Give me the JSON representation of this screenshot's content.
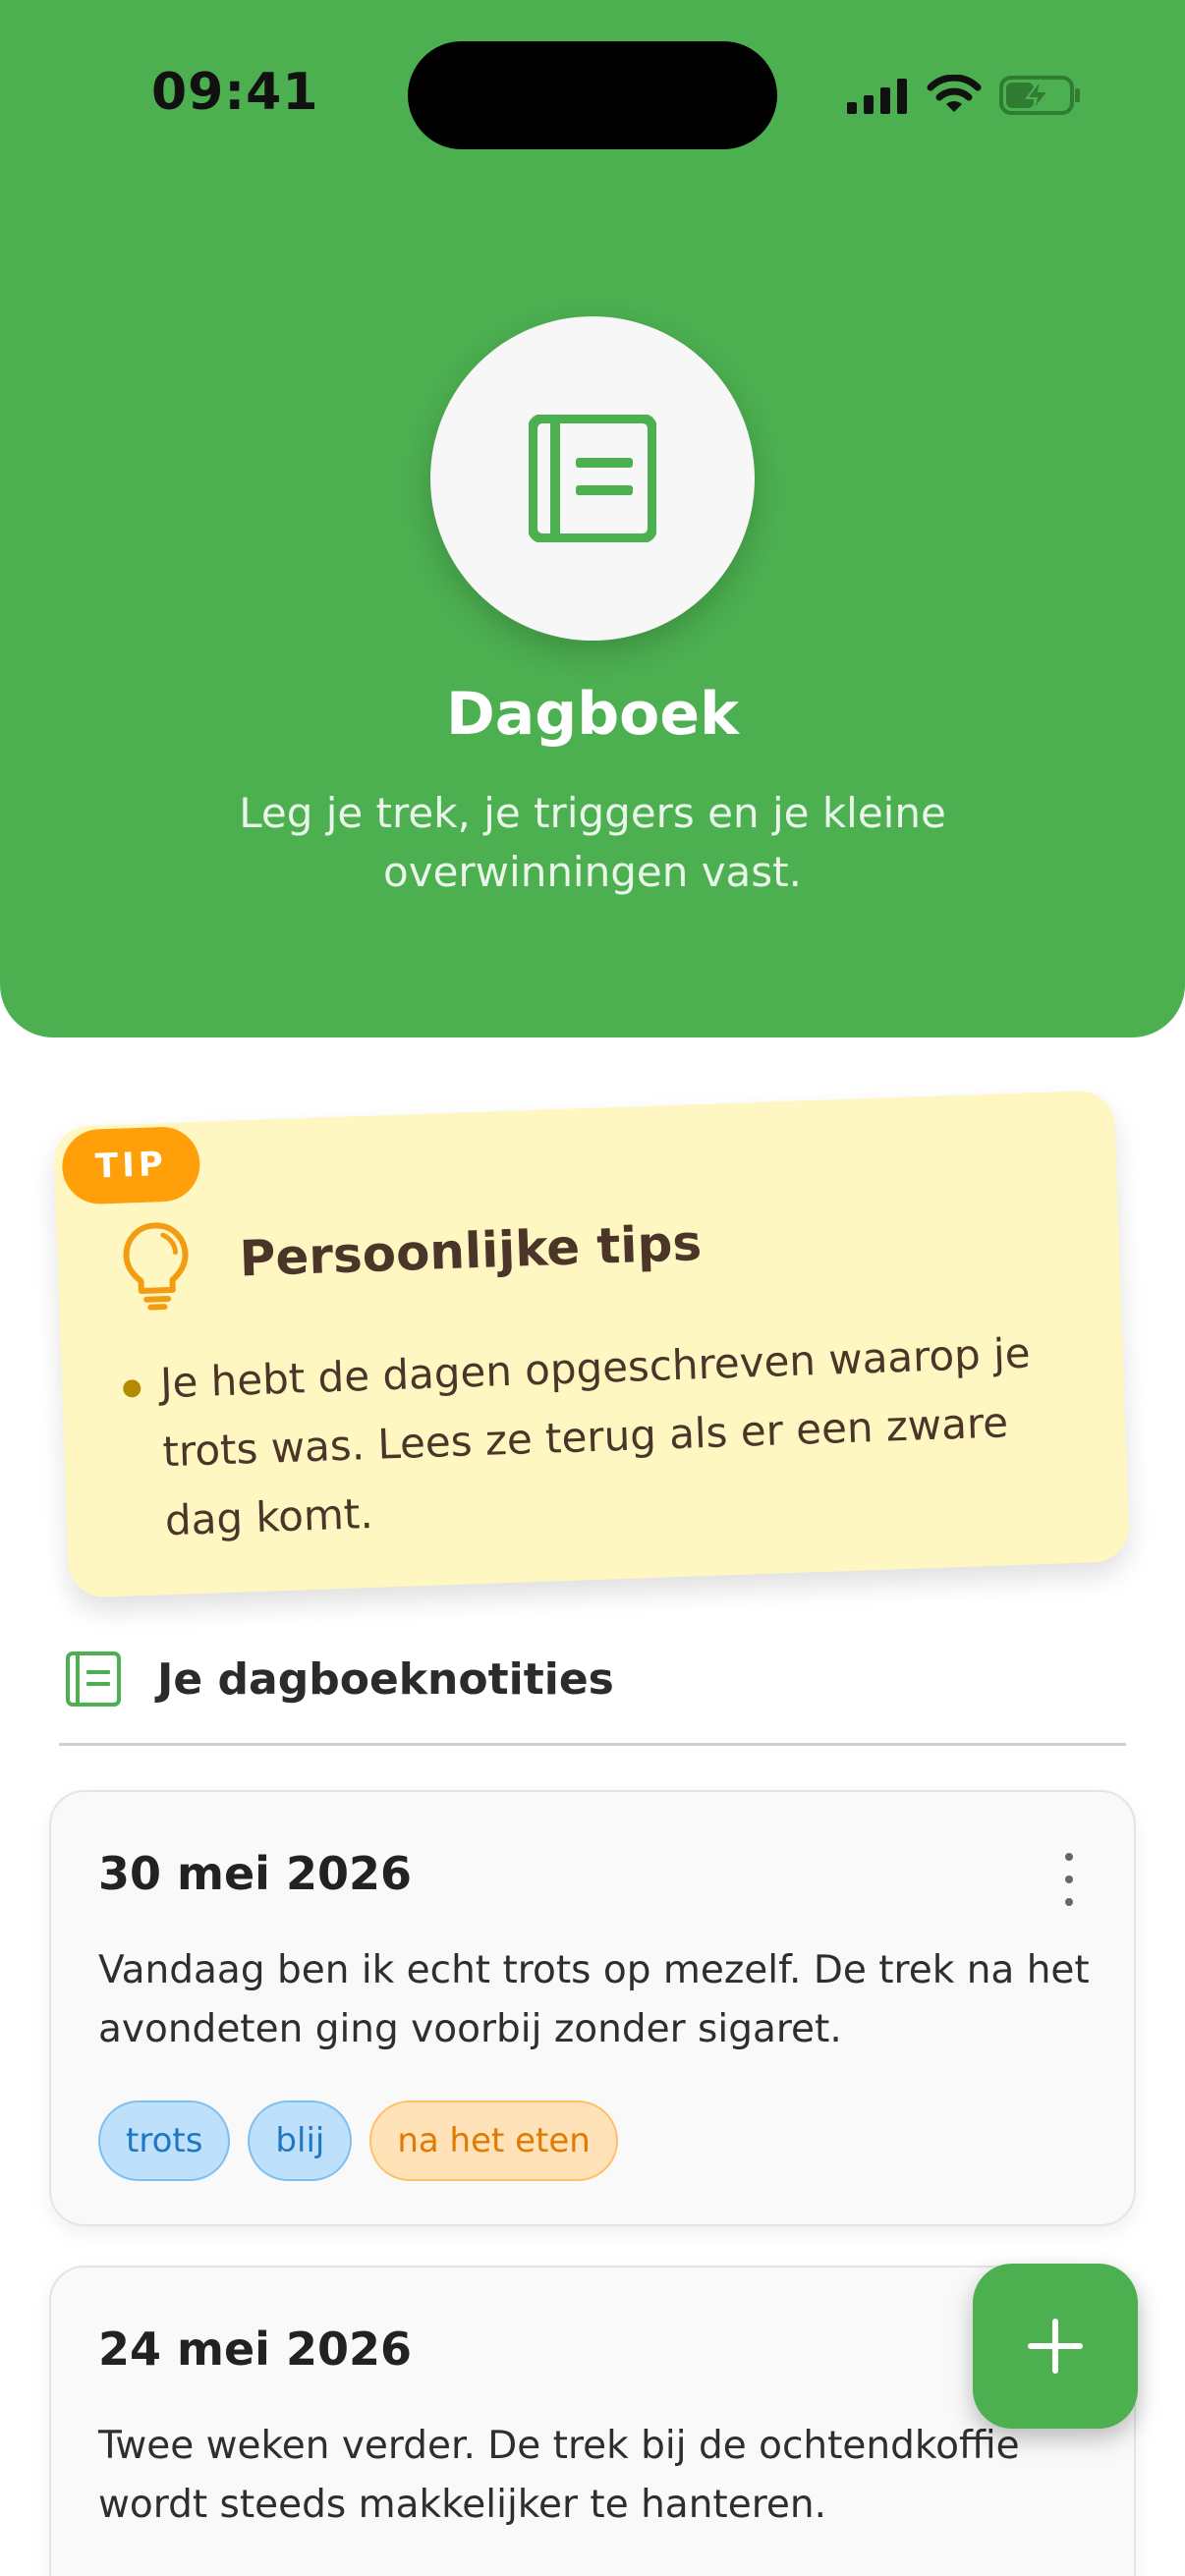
{
  "status_bar": {
    "time": "09:41"
  },
  "header": {
    "title": "Dagboek",
    "subtitle": "Leg je trek, je triggers en je kleine overwinningen vast.",
    "icon": "notebook-icon",
    "background_color": "#4caf50"
  },
  "tip_card": {
    "badge": "TIP",
    "title": "Persoonlijke tips",
    "icon": "lightbulb-icon",
    "items": [
      "Je hebt de dagen opgeschreven waarop je trots was. Lees ze terug als er een zware dag komt."
    ],
    "background_color": "#fff7c2",
    "badge_color": "#ff9f0a"
  },
  "notes_section": {
    "title": "Je dagboeknotities",
    "icon": "notebook-icon"
  },
  "entries": [
    {
      "date": "30 mei 2026",
      "text": "Vandaag ben ik echt trots op mezelf. De trek na het avondeten ging voorbij zonder sigaret.",
      "tags": [
        {
          "label": "trots",
          "color": "blue"
        },
        {
          "label": "blij",
          "color": "blue"
        },
        {
          "label": "na het eten",
          "color": "orange"
        }
      ]
    },
    {
      "date": "24 mei 2026",
      "text": "Twee weken verder. De trek bij de ochtendkoffie wordt steeds makkelijker te hanteren.",
      "tags": []
    }
  ],
  "fab": {
    "icon": "plus-icon"
  }
}
